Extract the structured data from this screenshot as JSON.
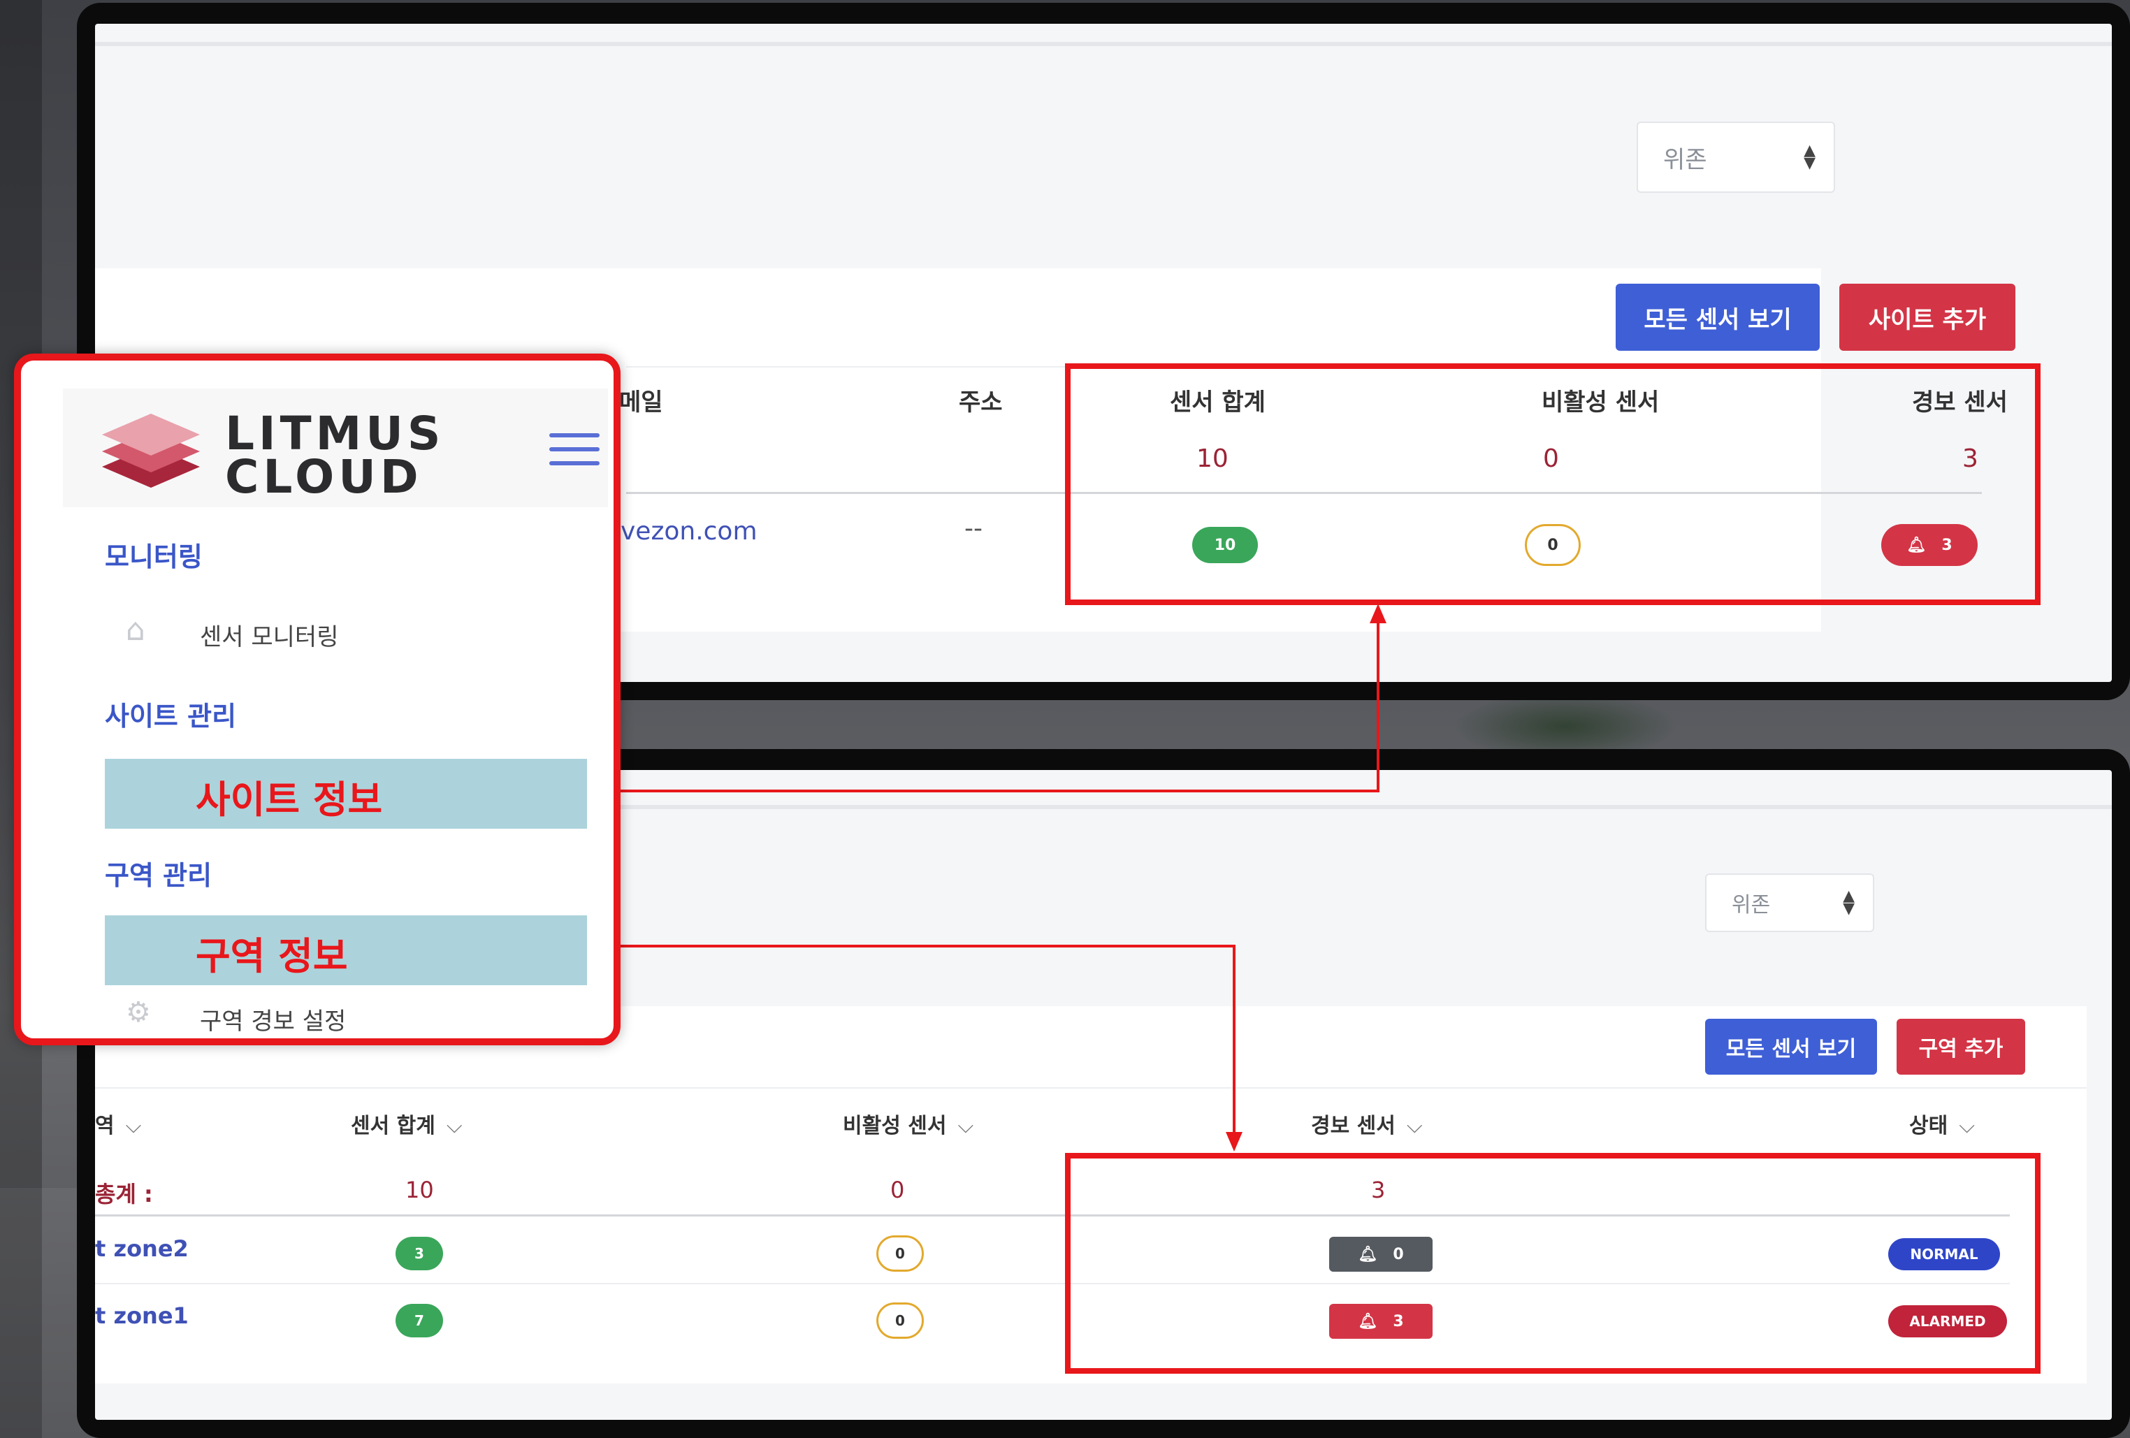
{
  "sidebar": {
    "logo_line1": "LITMUS",
    "logo_line2": "CLOUD",
    "section_monitoring": "모니터링",
    "item_sensor_monitoring": "센서 모니터링",
    "section_site_management": "사이트 관리",
    "item_site_info": "사이트 정보",
    "section_zone_management": "구역 관리",
    "item_zone_info": "구역 정보",
    "item_zone_alarm_settings": "구역 경보 설정"
  },
  "site_panel": {
    "select_value": "위존",
    "view_all_sensors_label": "모든 센서 보기",
    "add_site_label": "사이트 추가",
    "columns": {
      "email": "메일",
      "address": "주소",
      "sensor_total": "센서 합계",
      "inactive_sensor": "비활성 센서",
      "alarm_sensor": "경보 센서"
    },
    "totals": {
      "sensor_total": "10",
      "inactive_sensor": "0",
      "alarm_sensor": "3"
    },
    "row": {
      "email": "vezon.com",
      "address": "--",
      "sensor_total": "10",
      "inactive_sensor": "0",
      "alarm_sensor": "3"
    }
  },
  "zone_panel": {
    "select_value": "위존",
    "view_all_sensors_label": "모든 센서 보기",
    "add_zone_label": "구역 추가",
    "columns": {
      "zone": "역",
      "sensor_total": "센서 합계",
      "inactive_sensor": "비활성 센서",
      "alarm_sensor": "경보 센서",
      "status": "상태"
    },
    "totals": {
      "label": "총계 :",
      "sensor_total": "10",
      "inactive_sensor": "0",
      "alarm_sensor": "3"
    },
    "rows": [
      {
        "zone": "t zone2",
        "sensor_total": "3",
        "inactive_sensor": "0",
        "alarm_sensor": "0",
        "status": "NORMAL"
      },
      {
        "zone": "t zone1",
        "sensor_total": "7",
        "inactive_sensor": "0",
        "alarm_sensor": "3",
        "status": "ALARMED"
      }
    ]
  },
  "colors": {
    "highlight_red": "#e8171b",
    "primary_blue": "#3f5fd6",
    "danger_red": "#d33546",
    "success_green": "#3aa65a",
    "warning_outline": "#e3a92d",
    "highlight_cyan": "#acd3db"
  },
  "icons": [
    "layers-logo-icon",
    "hamburger-menu-icon",
    "home-icon",
    "gear-icon",
    "bell-icon",
    "sort-arrows-icon",
    "chevron-down-icon"
  ]
}
